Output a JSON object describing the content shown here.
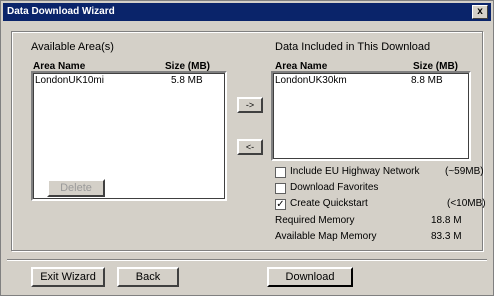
{
  "window": {
    "title": "Data Download Wizard",
    "close_glyph": "x"
  },
  "available": {
    "heading": "Available Area(s)",
    "col_name": "Area Name",
    "col_size": "Size (MB)",
    "rows": [
      {
        "name": "LondonUK10mi",
        "size": "5.8 MB"
      }
    ]
  },
  "included": {
    "heading": "Data Included in This Download",
    "col_name": "Area Name",
    "col_size": "Size (MB)",
    "rows": [
      {
        "name": "LondonUK30km",
        "size": "8.8 MB"
      }
    ]
  },
  "buttons": {
    "add": "->",
    "remove": "<-",
    "delete": "Delete",
    "exit": "Exit Wizard",
    "back": "Back",
    "download": "Download"
  },
  "options": {
    "eu_highway": {
      "label": "Include EU Highway Network",
      "size": "(~59MB)",
      "checked": false
    },
    "favorites": {
      "label": "Download Favorites",
      "checked": false
    },
    "quickstart": {
      "label": "Create Quickstart",
      "size": "(<10MB)",
      "checked": true
    }
  },
  "memory": {
    "required_label": "Required Memory",
    "required_value": "18.8 M",
    "available_label": "Available Map Memory",
    "available_value": "83.3 M"
  },
  "glyphs": {
    "checkmark": "✓"
  }
}
